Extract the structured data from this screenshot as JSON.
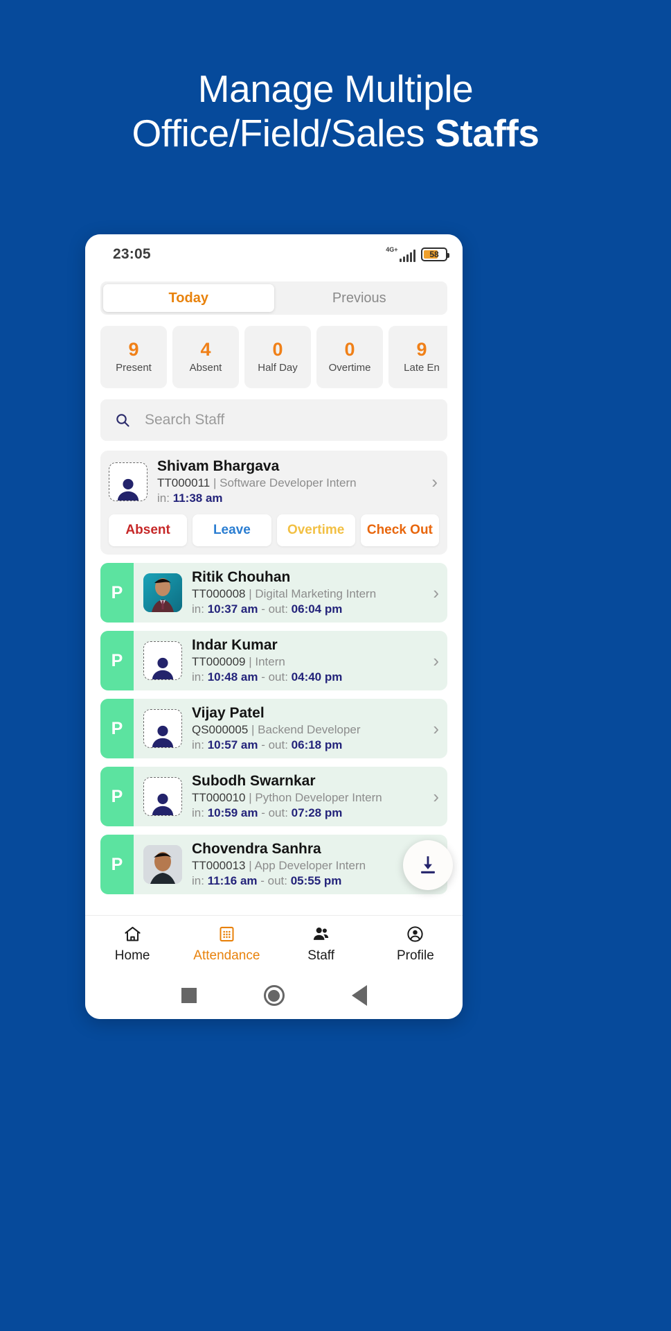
{
  "promo": {
    "line1": "Manage Multiple",
    "line2_light": "Office/Field/Sales ",
    "line2_bold": "Staffs",
    "bg_color": "#064A9B"
  },
  "status_bar": {
    "time": "23:05",
    "network_label": "4G+",
    "battery_percent": "58",
    "signal_icon": "signal-bars-icon",
    "battery_icon": "battery-icon"
  },
  "tabs": [
    {
      "label": "Today",
      "active": true
    },
    {
      "label": "Previous",
      "active": false
    }
  ],
  "stats": [
    {
      "value": "9",
      "label": "Present"
    },
    {
      "value": "4",
      "label": "Absent"
    },
    {
      "value": "0",
      "label": "Half Day"
    },
    {
      "value": "0",
      "label": "Overtime"
    },
    {
      "value": "9",
      "label": "Late En"
    }
  ],
  "search": {
    "placeholder": "Search Staff",
    "value": "",
    "icon": "search-icon"
  },
  "active_staff": {
    "name": "Shivam Bhargava",
    "code": "TT000011",
    "separator": " | ",
    "role": "Software Developer Intern",
    "in_label": "in: ",
    "in_time": "11:38 am",
    "avatar_icon": "person-placeholder-icon",
    "chevron": "›",
    "actions": [
      {
        "label": "Absent",
        "color": "#C62828"
      },
      {
        "label": "Leave",
        "color": "#2A7DD1"
      },
      {
        "label": "Overtime",
        "color": "#F2C044"
      },
      {
        "label": "Check Out",
        "color": "#E8660C"
      }
    ]
  },
  "staff_rows": [
    {
      "badge": "P",
      "name": "Ritik Chouhan",
      "code": "TT000008",
      "role": "Digital Marketing Intern",
      "in_label": "in: ",
      "in_time": "10:37 am",
      "out_label": " - out: ",
      "out_time": "06:04 pm",
      "has_photo": true,
      "chevron": "›"
    },
    {
      "badge": "P",
      "name": "Indar Kumar",
      "code": "TT000009",
      "role": "Intern",
      "in_label": "in: ",
      "in_time": "10:48 am",
      "out_label": " - out: ",
      "out_time": "04:40 pm",
      "has_photo": false,
      "chevron": "›"
    },
    {
      "badge": "P",
      "name": "Vijay Patel",
      "code": "QS000005",
      "role": "Backend Developer",
      "in_label": "in: ",
      "in_time": "10:57 am",
      "out_label": " - out: ",
      "out_time": "06:18 pm",
      "has_photo": false,
      "chevron": "›"
    },
    {
      "badge": "P",
      "name": "Subodh Swarnkar",
      "code": "TT000010",
      "role": "Python Developer Intern",
      "in_label": "in: ",
      "in_time": "10:59 am",
      "out_label": " - out: ",
      "out_time": "07:28 pm",
      "has_photo": false,
      "chevron": "›"
    },
    {
      "badge": "P",
      "name": "Chovendra Sanhra",
      "code": "TT000013",
      "role": "App Developer Intern",
      "in_label": "in: ",
      "in_time": "11:16 am",
      "out_label": " - out: ",
      "out_time": "05:55 pm",
      "has_photo": true,
      "chevron": "›"
    }
  ],
  "fab": {
    "icon": "download-icon"
  },
  "bottom_nav": [
    {
      "label": "Home",
      "icon": "home-icon",
      "active": false
    },
    {
      "label": "Attendance",
      "icon": "calendar-grid-icon",
      "active": true
    },
    {
      "label": "Staff",
      "icon": "people-icon",
      "active": false
    },
    {
      "label": "Profile",
      "icon": "account-circle-icon",
      "active": false
    }
  ],
  "system_bar": [
    {
      "icon": "recents-square-icon"
    },
    {
      "icon": "home-circle-icon"
    },
    {
      "icon": "back-triangle-icon"
    }
  ],
  "colors": {
    "brand_blue": "#064A9B",
    "accent_orange": "#E8820C",
    "present_green": "#5CE3A0",
    "time_navy": "#23237A"
  }
}
